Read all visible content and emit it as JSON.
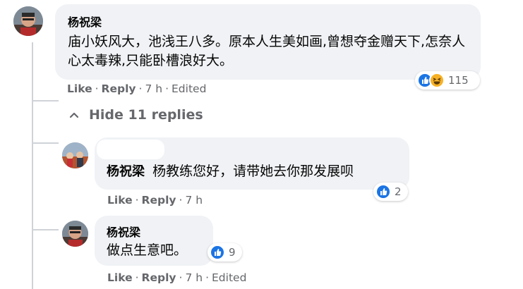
{
  "comments": [
    {
      "author": "杨祝梁",
      "text": "庙小妖风大，池浅王八多。原本人生美如画,曾想夺金赠天下,怎奈人心太毒辣,只能卧槽浪好大。",
      "actions": {
        "like": "Like",
        "reply": "Reply",
        "time": "7 h",
        "edited": "Edited"
      },
      "reactions": {
        "icons": [
          "like-icon",
          "haha-icon"
        ],
        "count": "115"
      }
    }
  ],
  "hide_replies": {
    "label": "Hide 11 replies",
    "icon": "chevron-up-icon"
  },
  "replies": [
    {
      "author": "杨祝梁",
      "text": "杨教练您好，请带她去你那发展呗",
      "actions": {
        "like": "Like",
        "reply": "Reply",
        "time": "7 h"
      },
      "reactions": {
        "icons": [
          "like-icon"
        ],
        "count": "2"
      }
    },
    {
      "author": "杨祝梁",
      "text": "做点生意吧。",
      "actions": {
        "like": "Like",
        "reply": "Reply",
        "time": "7 h",
        "edited": "Edited"
      },
      "reactions": {
        "icons": [
          "like-icon"
        ],
        "count": "9"
      }
    }
  ],
  "colors": {
    "bubble": "#f0f2f5",
    "meta_text": "#65676b",
    "like_blue": "#1b74e4",
    "haha_yellow": "#f7b125"
  }
}
